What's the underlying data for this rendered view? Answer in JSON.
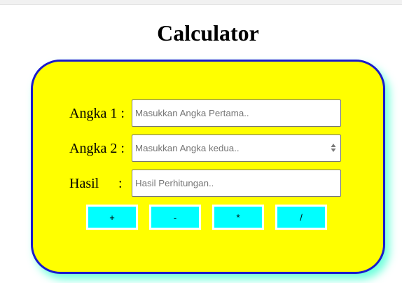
{
  "page": {
    "title": "Calculator"
  },
  "form": {
    "angka1": {
      "label": "Angka 1 :",
      "placeholder": "Masukkan Angka Pertama..",
      "value": ""
    },
    "angka2": {
      "label": "Angka 2 :",
      "placeholder": "Masukkan Angka kedua..",
      "value": ""
    },
    "hasil": {
      "label": "Hasil",
      "colon": ":",
      "placeholder": "Hasil Perhitungan..",
      "value": ""
    }
  },
  "operators": {
    "add": "+",
    "subtract": "-",
    "multiply": "*",
    "divide": "/"
  },
  "colors": {
    "card_background": "#ffff00",
    "card_border": "#1a1acc",
    "card_shadow": "#40ffd0",
    "button_background": "#00ffff"
  },
  "icons": {
    "number_spinner": "spinner-arrows-icon"
  }
}
